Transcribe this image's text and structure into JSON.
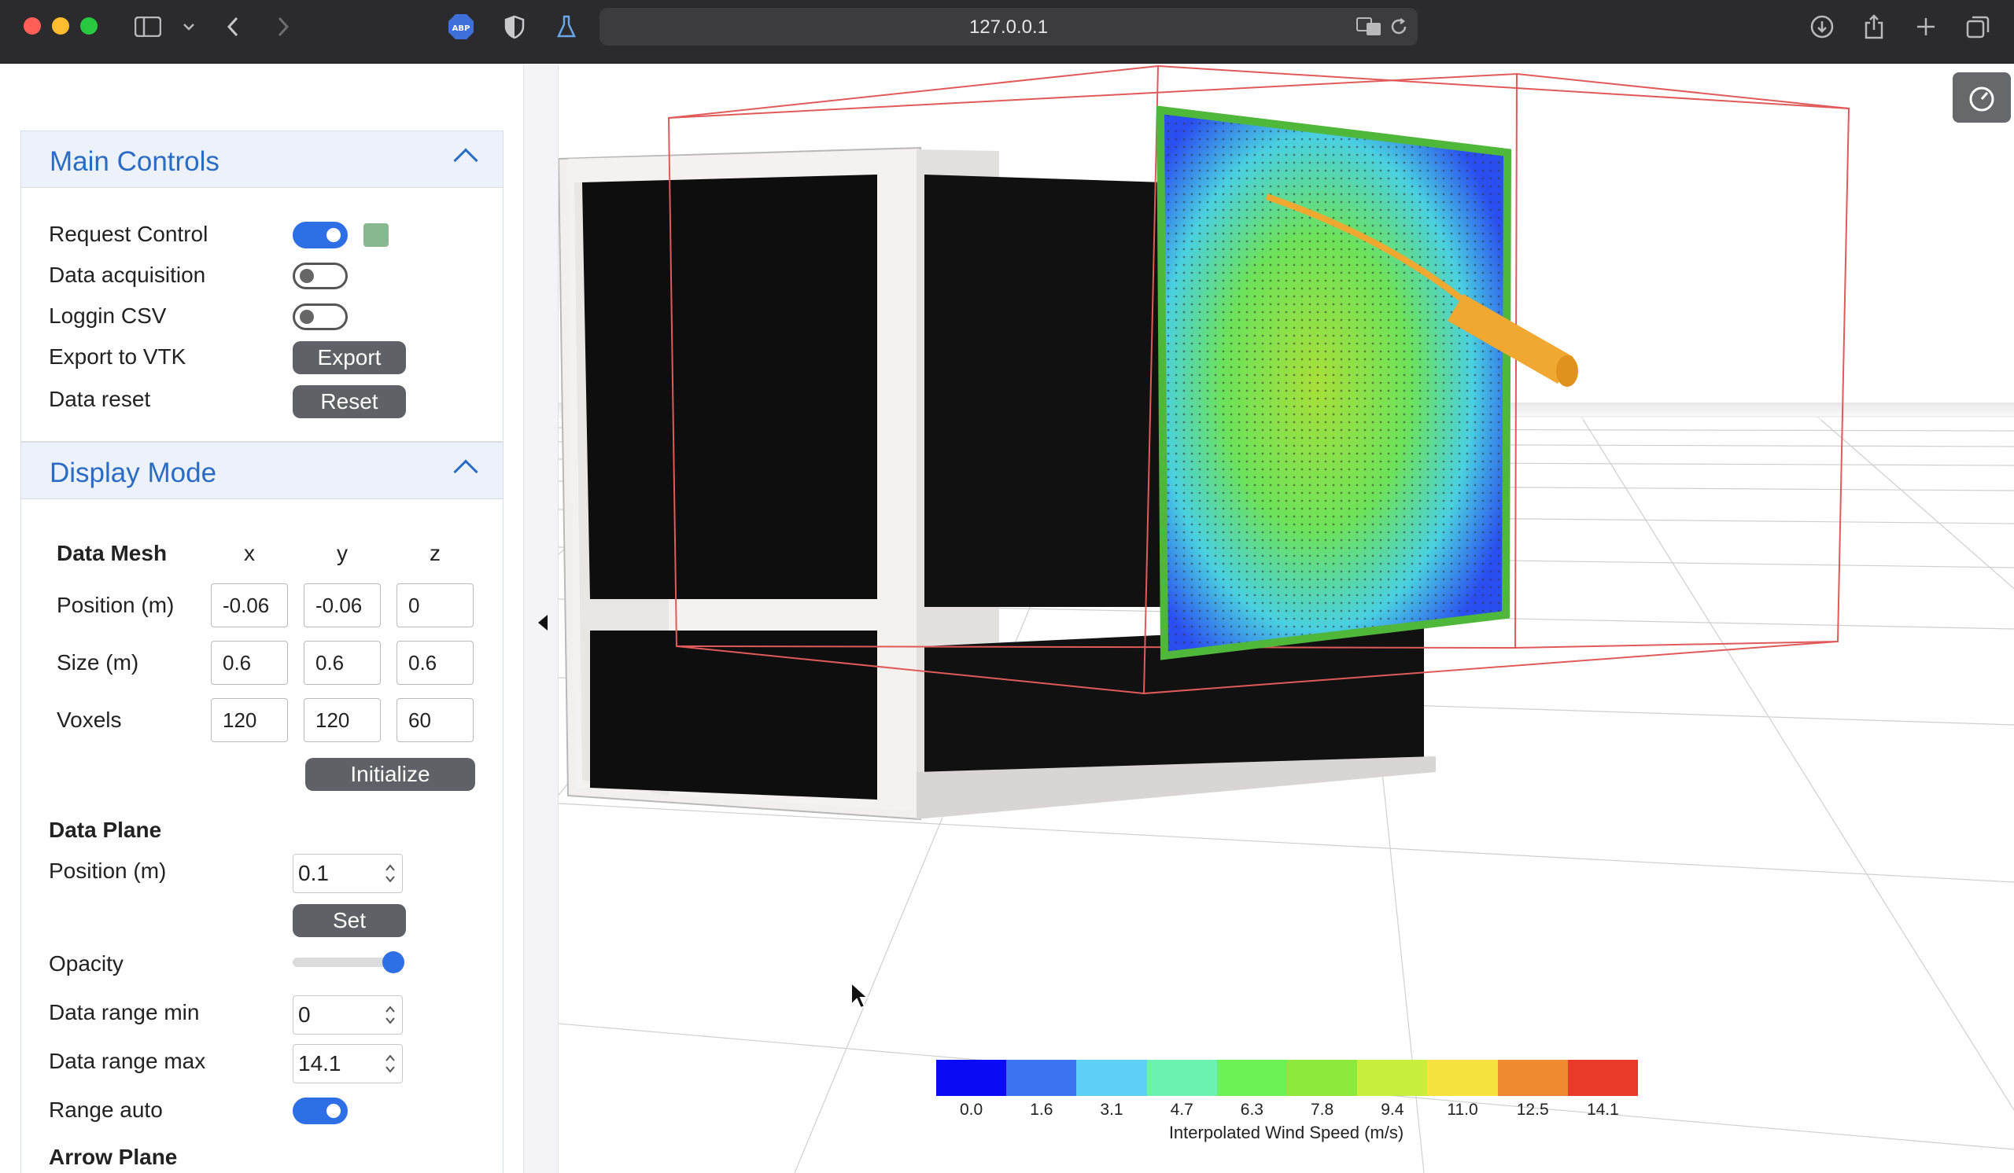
{
  "browser": {
    "url": "127.0.0.1"
  },
  "main_controls": {
    "title": "Main Controls",
    "request_control": {
      "label": "Request Control",
      "on": true
    },
    "data_acquisition": {
      "label": "Data acquisition",
      "on": false
    },
    "logging_csv": {
      "label": "Loggin CSV",
      "on": false
    },
    "export_vtk": {
      "label": "Export to VTK",
      "button": "Export"
    },
    "data_reset": {
      "label": "Data reset",
      "button": "Reset"
    }
  },
  "display_mode": {
    "title": "Display Mode",
    "data_mesh": {
      "heading": "Data Mesh",
      "axes": [
        "x",
        "y",
        "z"
      ],
      "position": {
        "label": "Position (m)",
        "values": [
          "-0.06",
          "-0.06",
          "0"
        ]
      },
      "size": {
        "label": "Size (m)",
        "values": [
          "0.6",
          "0.6",
          "0.6"
        ]
      },
      "voxels": {
        "label": "Voxels",
        "values": [
          "120",
          "120",
          "60"
        ]
      },
      "initialize_button": "Initialize"
    },
    "data_plane": {
      "heading": "Data Plane",
      "position_label": "Position (m)",
      "position_value": "0.1",
      "set_button": "Set"
    },
    "opacity": {
      "label": "Opacity",
      "value": 1.0
    },
    "range_min": {
      "label": "Data range min",
      "value": "0"
    },
    "range_max": {
      "label": "Data range max",
      "value": "14.1"
    },
    "range_auto": {
      "label": "Range auto",
      "on": true
    },
    "arrow_plane": {
      "heading": "Arrow Plane"
    }
  },
  "colorbar": {
    "title": "Interpolated Wind Speed (m/s)",
    "ticks": [
      "0.0",
      "1.6",
      "3.1",
      "4.7",
      "6.3",
      "7.8",
      "9.4",
      "11.0",
      "12.5",
      "14.1"
    ],
    "colors": [
      "#0a0af5",
      "#3a74f0",
      "#5dd0f5",
      "#6cf2b0",
      "#6df256",
      "#8fe83c",
      "#c8ef3c",
      "#f7e240",
      "#f08a30",
      "#ea3a2a"
    ]
  }
}
